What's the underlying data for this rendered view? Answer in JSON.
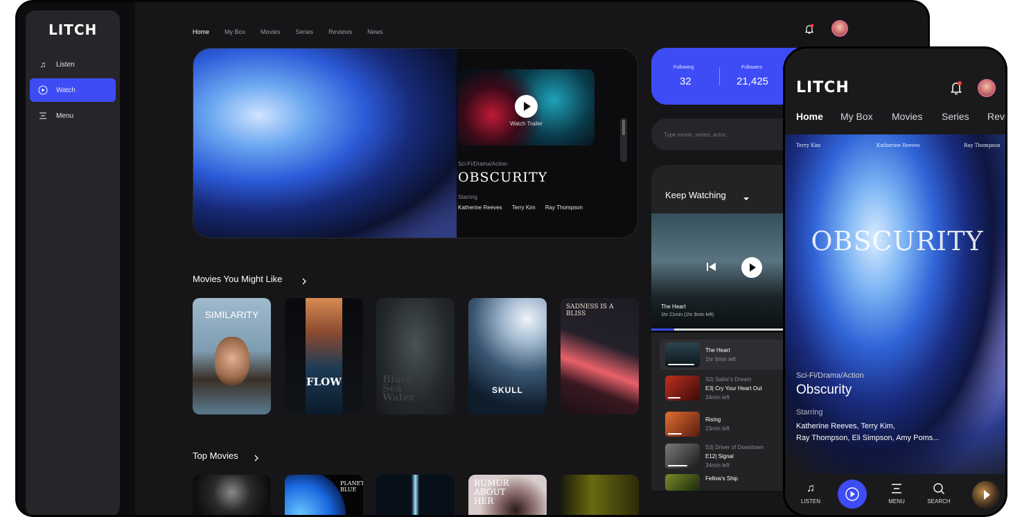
{
  "app": {
    "logo": "LITCH"
  },
  "sidebar": {
    "items": [
      {
        "label": "Listen",
        "icon": "music-note-icon"
      },
      {
        "label": "Watch",
        "icon": "play-circle-icon",
        "active": true
      },
      {
        "label": "Menu",
        "icon": "menu-icon"
      }
    ]
  },
  "topnav": {
    "items": [
      "Home",
      "My Box",
      "Movies",
      "Series",
      "Reviews",
      "News"
    ]
  },
  "hero": {
    "trailer_label": "Watch Trailer",
    "genre": "Sci-Fi/Drama/Action",
    "title": "OBSCURITY",
    "starring_label": "Starring",
    "stars": [
      "Katherine Reeves",
      "Terry Kim",
      "Ray Thompson"
    ]
  },
  "stats": {
    "following_label": "Following",
    "following": "32",
    "followers_label": "Followers",
    "followers": "21,425"
  },
  "search": {
    "placeholder": "Type movie, series, actor..."
  },
  "keep_watching": {
    "title": "Keep Watching",
    "now": {
      "title": "The Heart",
      "time": "1hr 21min (1hr 9min left)",
      "progress": 0.15
    },
    "items": [
      {
        "line1": "",
        "title": "The Heart",
        "time": "1hr 9min left",
        "progress": 0.9
      },
      {
        "line1": "S2| Sailor's Dream",
        "title": "E3| Cry Your Heart Out",
        "time": "34min left",
        "progress": 0.4
      },
      {
        "line1": "",
        "title": "Rising",
        "time": "23min left",
        "progress": 0.45
      },
      {
        "line1": "S3| Driver of Downtown",
        "title": "E12| Signal",
        "time": "34min left",
        "progress": 0.6
      },
      {
        "line1": "",
        "title": "Fellow's Ship",
        "time": "",
        "progress": 0.0
      }
    ]
  },
  "movies_section": {
    "title": "Movies You Might Like",
    "posters": [
      {
        "text": "SIMILARITY",
        "colors": [
          "#8fb0c9",
          "#6d8ea5",
          "#4a5f70"
        ]
      },
      {
        "text": "FLOW",
        "colors": [
          "#2a2f3a",
          "#1e3b56",
          "#101418"
        ]
      },
      {
        "text": "Black Sea Water",
        "colors": [
          "#2c3236",
          "#1c2124",
          "#3a3f42"
        ]
      },
      {
        "text": "SKULL",
        "colors": [
          "#c8d6e2",
          "#4e6a86",
          "#15283c"
        ]
      },
      {
        "text": "SADNESS IS A BLISS",
        "colors": [
          "#1c1c24",
          "#3a1f2a",
          "#e8606a"
        ]
      }
    ]
  },
  "top_section": {
    "title": "Top Movies",
    "posters": [
      {
        "text": "",
        "colors": [
          "#1a1a1a",
          "#3a3a3a",
          "#0e0e0e"
        ]
      },
      {
        "text": "PLANET BLUE",
        "colors": [
          "#111",
          "#0a3a8a",
          "#3fa6f5"
        ]
      },
      {
        "text": "",
        "colors": [
          "#071018",
          "#0f2030",
          "#061018"
        ]
      },
      {
        "text": "RUMUR ABOUT HER",
        "colors": [
          "#d0c4c4",
          "#b39a9a",
          "#604848"
        ]
      },
      {
        "text": "",
        "colors": [
          "#2a2a10",
          "#5a5a10",
          "#1a1a0a"
        ]
      }
    ]
  },
  "phone": {
    "logo": "LITCH",
    "nav": [
      "Home",
      "My Box",
      "Movies",
      "Series",
      "Revie"
    ],
    "poster_names": [
      "Terry Kim",
      "Katherine Reeves",
      "Ray Thompson"
    ],
    "poster_title": "OBSCURITY",
    "genre": "Sci-Fi/Drama/Action",
    "title": "Obscurity",
    "starring_label": "Starring",
    "stars_line1": "Katherine Reeves, Terry Kim,",
    "stars_line2": "Ray Thompson, Eli Simpson, Amy Poms...",
    "tabbar": [
      {
        "label": "LISTEN",
        "icon": "music-note-icon"
      },
      {
        "label": "",
        "icon": "play-circle-icon"
      },
      {
        "label": "MENU",
        "icon": "menu-icon"
      },
      {
        "label": "SEARCH",
        "icon": "search-icon"
      }
    ]
  },
  "colors": {
    "accent": "#3d4cf5",
    "bg": "#161618",
    "sidebar": "#26262a",
    "notification": "#ff3b30"
  }
}
